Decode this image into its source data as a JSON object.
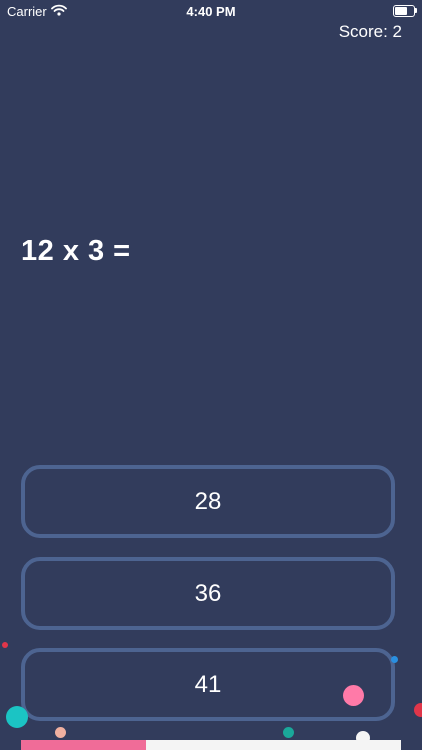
{
  "status_bar": {
    "carrier": "Carrier",
    "time": "4:40 PM",
    "icons": [
      "wifi-icon",
      "battery-icon"
    ]
  },
  "header": {
    "score_label": "Score: 2"
  },
  "question": {
    "text": "12 x 3 ="
  },
  "answers": [
    {
      "label": "28"
    },
    {
      "label": "36"
    },
    {
      "label": "41"
    }
  ],
  "progress": {
    "fraction": 0.33
  },
  "colors": {
    "background": "#323c5c",
    "answer_border": "#4d6491",
    "progress_fill": "#f06c98",
    "progress_track": "#f4f4f4",
    "confetti": [
      "#1bc4c4",
      "#ff7aa8",
      "#1aa89a",
      "#e0364a",
      "#2a8fe0",
      "#f0b0a0",
      "#f5f5f5"
    ]
  }
}
